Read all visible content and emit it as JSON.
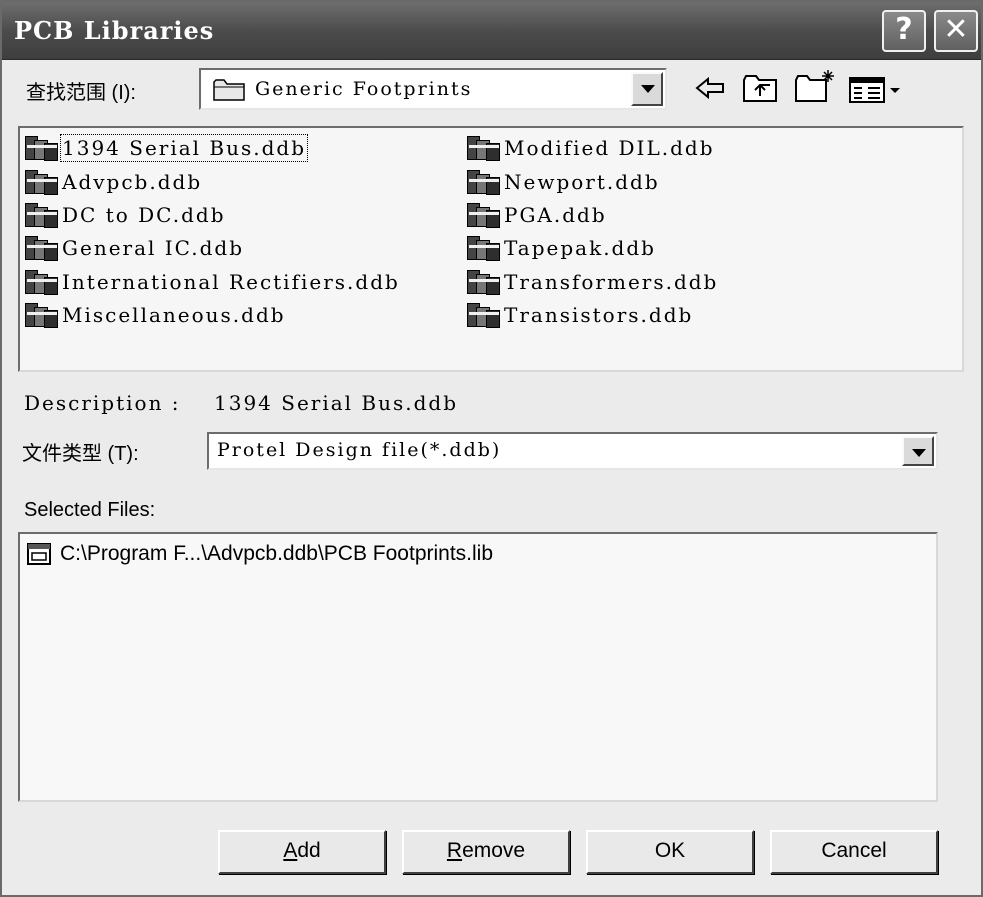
{
  "window": {
    "title": "PCB Libraries",
    "help_label": "?",
    "close_label": "✕"
  },
  "look_in": {
    "label": "查找范围 (I):",
    "value": "Generic Footprints",
    "icon": "folder-icon"
  },
  "toolbar": [
    "back-arrow-icon",
    "up-folder-icon",
    "new-folder-icon",
    "view-menu-icon"
  ],
  "files": [
    "1394 Serial Bus.ddb",
    "Advpcb.ddb",
    "DC to DC.ddb",
    "General IC.ddb",
    "International Rectifiers.ddb",
    "Miscellaneous.ddb",
    "Modified DIL.ddb",
    "Newport.ddb",
    "PGA.ddb",
    "Tapepak.ddb",
    "Transformers.ddb",
    "Transistors.ddb"
  ],
  "selected_file": "1394 Serial Bus.ddb",
  "description": {
    "label": "Description :",
    "value": "1394 Serial Bus.ddb"
  },
  "file_type": {
    "label": "文件类型 (T):",
    "value": "Protel Design file(*.ddb)"
  },
  "selected_files": {
    "label": "Selected Files:",
    "items": [
      "C:\\Program F...\\Advpcb.ddb\\PCB Footprints.lib"
    ]
  },
  "buttons": {
    "add": {
      "mnemonic": "A",
      "rest": "dd"
    },
    "remove": {
      "mnemonic": "R",
      "rest": "emove"
    },
    "ok": "OK",
    "cancel": "Cancel"
  }
}
